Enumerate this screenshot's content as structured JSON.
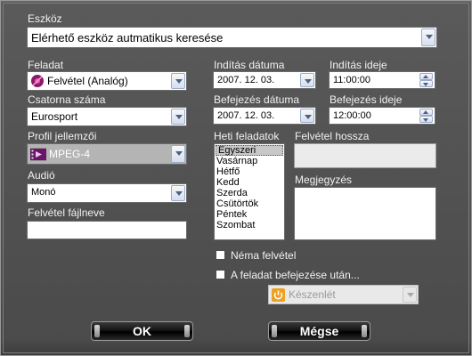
{
  "device": {
    "label": "Eszköz",
    "value": "Elérhető eszköz autmatikus keresése"
  },
  "task": {
    "label": "Feladat",
    "value": "Felvétel (Analóg)",
    "icon": "record-disc-icon"
  },
  "channel": {
    "label": "Csatorna száma",
    "value": "Eurosport"
  },
  "profile": {
    "label": "Profil jellemzői",
    "value": "MPEG-4",
    "icon": "video-profile-icon"
  },
  "audio": {
    "label": "Audió",
    "value": "Monó"
  },
  "filename": {
    "label": "Felvétel fájlneve",
    "value": ""
  },
  "start_date": {
    "label": "Indítás dátuma",
    "value": "2007. 12. 03."
  },
  "start_time": {
    "label": "Indítás ideje",
    "value": "11:00:00"
  },
  "end_date": {
    "label": "Befejezés dátuma",
    "value": "2007. 12. 03."
  },
  "end_time": {
    "label": "Befejezés ideje",
    "value": "12:00:00"
  },
  "weekly": {
    "label": "Heti feladatok",
    "items": [
      "Egyszeri",
      "Vasárnap",
      "Hétfő",
      "Kedd",
      "Szerda",
      "Csütörtök",
      "Péntek",
      "Szombat"
    ],
    "selected": "Egyszeri"
  },
  "duration": {
    "label": "Felvétel hossza",
    "value": ""
  },
  "note": {
    "label": "Megjegyzés",
    "value": ""
  },
  "mute": {
    "label": "Néma felvétel",
    "checked": false
  },
  "after_task": {
    "label": "A feladat befejezése után...",
    "checked": false,
    "action_value": "Készenlét",
    "action_icon": "power-icon"
  },
  "buttons": {
    "ok": "OK",
    "cancel": "Mégse"
  },
  "colors": {
    "background": "#4b4b4b",
    "label_text": "#f2f2f2",
    "button_face": "#000000",
    "accent_power": "#f0a020",
    "profile_icon": "#8a1a7a"
  }
}
